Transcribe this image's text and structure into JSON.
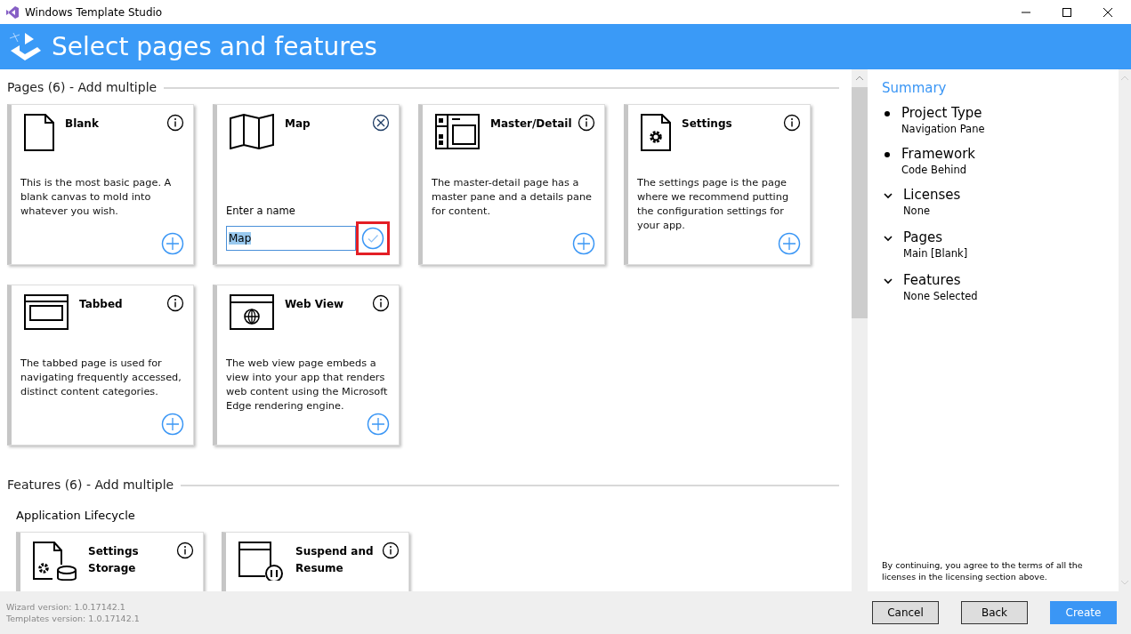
{
  "window": {
    "title": "Windows Template Studio"
  },
  "header": {
    "title": "Select pages and features"
  },
  "pages_section": {
    "title": "Pages (6) - Add multiple",
    "cards": [
      {
        "title": "Blank",
        "description": "This is the most basic page. A blank canvas to mold into whatever you wish.",
        "editing": false
      },
      {
        "title": "Map",
        "editing": true,
        "name_label": "Enter a name",
        "name_value": "Map",
        "confirm_highlighted": true
      },
      {
        "title": "Master/Detail",
        "description": "The master-detail page has a master pane and a details pane for content.",
        "editing": false
      },
      {
        "title": "Settings",
        "description": "The settings page is the page where we recommend putting the configuration settings for your app.",
        "editing": false
      },
      {
        "title": "Tabbed",
        "description": "The tabbed page is used for navigating frequently accessed, distinct content categories.",
        "editing": false
      },
      {
        "title": "Web View",
        "description": "The web view page embeds a view into your app that renders web content using the Microsoft Edge rendering engine.",
        "editing": false
      }
    ]
  },
  "features_section": {
    "title": "Features (6) - Add multiple",
    "groups": [
      {
        "title": "Application Lifecycle",
        "cards": [
          {
            "title": "Settings Storage"
          },
          {
            "title": "Suspend and Resume"
          }
        ]
      }
    ]
  },
  "summary": {
    "title": "Summary",
    "items": [
      {
        "kind": "bullet",
        "title": "Project Type",
        "value": "Navigation Pane"
      },
      {
        "kind": "bullet",
        "title": "Framework",
        "value": "Code Behind"
      },
      {
        "kind": "group",
        "expanded": true,
        "title": "Licenses",
        "value": "None"
      },
      {
        "kind": "group",
        "expanded": true,
        "title": "Pages",
        "value": "Main [Blank]"
      },
      {
        "kind": "group",
        "expanded": true,
        "title": "Features",
        "value": "None Selected"
      }
    ],
    "note": "By continuing, you agree to the terms of all the licenses in the licensing section above."
  },
  "footer": {
    "versions": [
      "Wizard version: 1.0.17142.1",
      "Templates version: 1.0.17142.1"
    ],
    "buttons": [
      {
        "label": "Cancel",
        "primary": false
      },
      {
        "label": "Back",
        "primary": false
      },
      {
        "label": "Create",
        "primary": true
      }
    ]
  }
}
